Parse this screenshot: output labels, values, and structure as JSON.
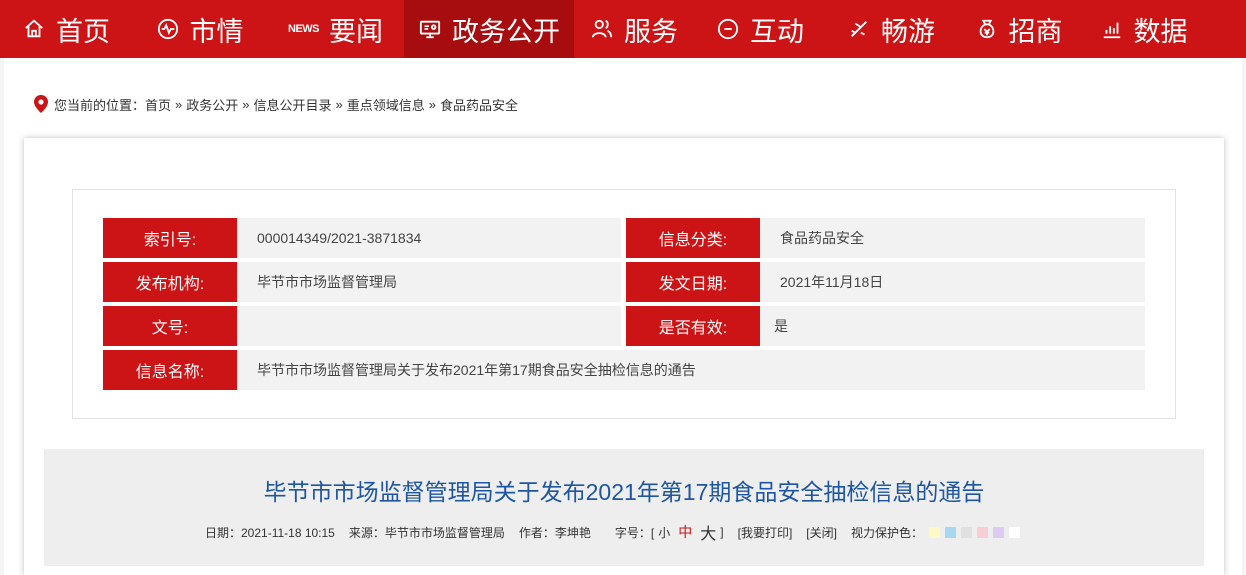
{
  "nav": {
    "items": [
      {
        "label": "首页",
        "icon": "home-icon"
      },
      {
        "label": "市情",
        "icon": "pulse-icon"
      },
      {
        "label": "要闻",
        "icon": "news-icon",
        "icon_text": "NEWS"
      },
      {
        "label": "政务公开",
        "icon": "monitor-icon",
        "active": true
      },
      {
        "label": "服务",
        "icon": "people-icon"
      },
      {
        "label": "互动",
        "icon": "chat-icon"
      },
      {
        "label": "畅游",
        "icon": "plane-icon"
      },
      {
        "label": "招商",
        "icon": "money-bag-icon"
      },
      {
        "label": "数据",
        "icon": "bar-chart-icon"
      }
    ]
  },
  "breadcrumb": {
    "prefix": "您当前的位置：",
    "items": [
      "首页",
      "政务公开",
      "信息公开目录",
      "重点领域信息",
      "食品药品安全"
    ],
    "separator": "»"
  },
  "meta": {
    "index_label": "索引号:",
    "index_value": "000014349/2021-3871834",
    "category_label": "信息分类:",
    "category_value": "食品药品安全",
    "publisher_label": "发布机构:",
    "publisher_value": "毕节市市场监督管理局",
    "date_label": "发文日期:",
    "date_value": "2021年11月18日",
    "docno_label": "文号:",
    "docno_value": "",
    "valid_label": "是否有效:",
    "valid_value": "是",
    "name_label": "信息名称:",
    "name_value": "毕节市市场监督管理局关于发布2021年第17期食品安全抽检信息的通告"
  },
  "article": {
    "title": "毕节市市场监督管理局关于发布2021年第17期食品安全抽检信息的通告",
    "date": "日期：2021-11-18 10:15",
    "source": "来源：毕节市市场监督管理局",
    "author": "作者：李坤艳",
    "font_size_label": "字号：[",
    "font_small": "小",
    "font_mid": "中",
    "font_big": "大",
    "font_close": "]",
    "print": "[我要打印]",
    "close": "[关闭]",
    "eye_care_label": "视力保护色：",
    "eye_colors": [
      "#fbf9c4",
      "#a8d8f0",
      "#e0e0e0",
      "#f7cdd6",
      "#dccbf2",
      "#ffffff"
    ]
  },
  "colors": {
    "brand": "#cc1416",
    "brand_dark": "#a70d0f",
    "title_blue": "#1f56a3"
  }
}
